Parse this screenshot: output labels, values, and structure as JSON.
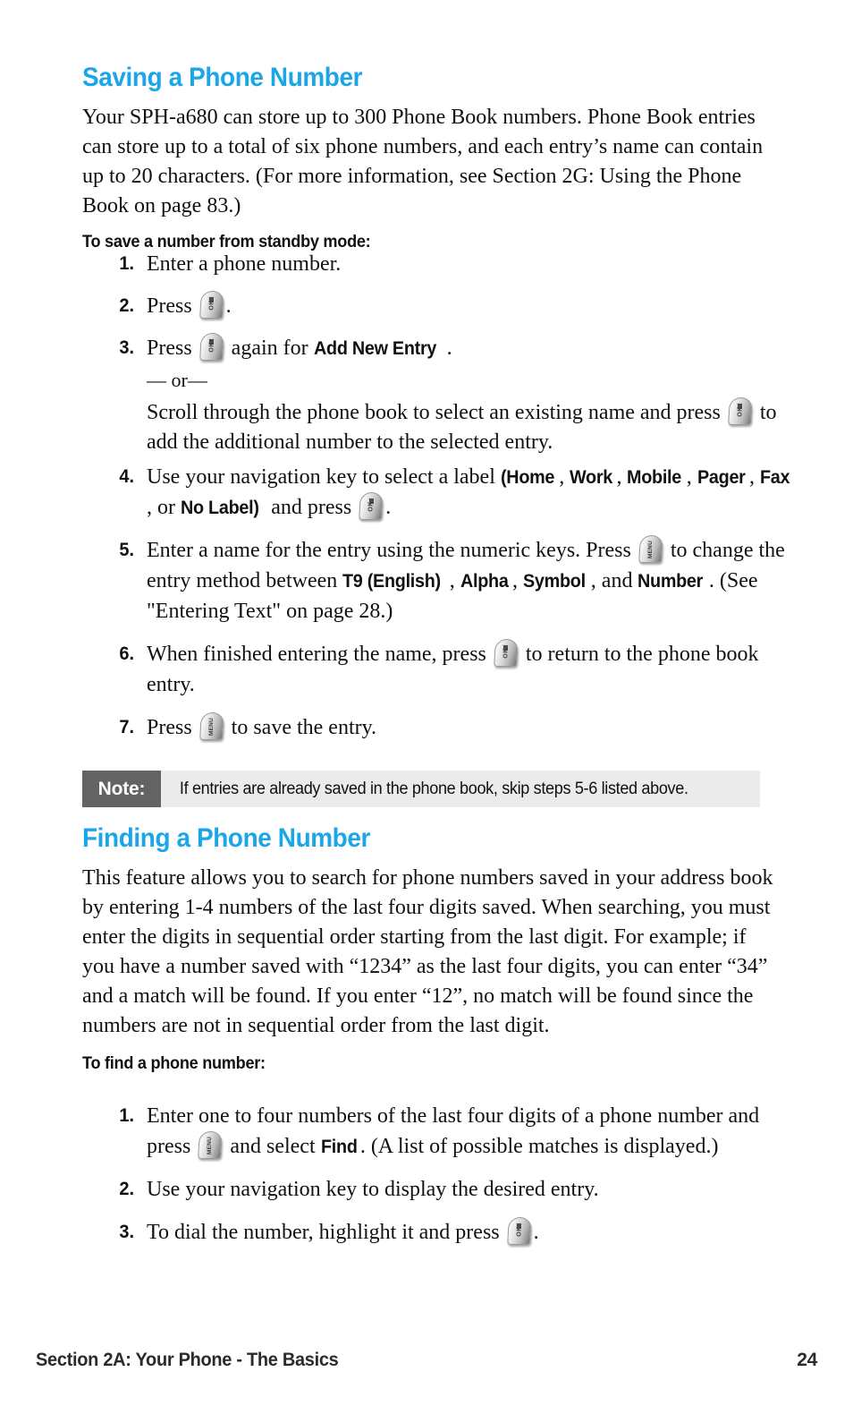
{
  "document": {
    "page_number": "24",
    "footer_left": "Section 2A: Your Phone - The Basics",
    "accent_color": "#1BA6E8",
    "note_label_bg": "#636363",
    "note_body_bg": "#ebebeb"
  },
  "sections": [
    {
      "heading": "Saving a Phone Number",
      "intro": "Your SPH-a680 can store up to 300 Phone Book numbers. Phone Book entries can store up to a total of six phone numbers, and each entry’s name can contain up to 20 characters. (For more information, see Section 2G: Using the Phone Book on page 83.)",
      "subheading": "To save a number from standby mode:",
      "steps": [
        {
          "num": "1.",
          "text": "Enter a phone number."
        },
        {
          "num": "2.",
          "text_before": "Press ",
          "icon": "ok-key-icon",
          "text_after": "."
        },
        {
          "num": "3.",
          "text_before": "Press ",
          "icon": "ok-key-icon",
          "text_mid": " again for ",
          "bold1": "Add New Entry",
          "text_after": "."
        },
        {
          "num": "4.",
          "text_before": "Use your navigation key to select a label ",
          "bold_open": "(Home",
          "b_sep1": ", ",
          "bold2": "Work",
          "b_sep2": ", ",
          "bold3": "Mobile",
          "b_sep3": ", ",
          "bold4": "Pager",
          "b_sep4": ", ",
          "bold5": "Fax",
          "b_sep5": ", or ",
          "bold6": "No Label)",
          "text_mid": " and press ",
          "icon": "ok-key-icon",
          "text_after": "."
        },
        {
          "num": "5.",
          "text_before": "Enter a name for the entry using the numeric keys. Press ",
          "icon": "menu-key-icon",
          "text_mid": " to change the entry method between ",
          "bold1": "T9 (English)",
          "b_sep1": ", ",
          "bold2": "Alpha",
          "b_sep2": ", ",
          "bold3": "Symbol",
          "b_sep3": ", and ",
          "bold4": "Number",
          "text_after": ". (See \"Entering Text\" on page 28.)"
        },
        {
          "num": "6.",
          "text_before": "When finished entering the name, press ",
          "icon": "ok-key-icon",
          "text_after": " to return to the phone book entry."
        },
        {
          "num": "7.",
          "text_before": "Press ",
          "icon": "menu-key-icon",
          "text_after": " to save the entry."
        }
      ],
      "or_divider": "— or—",
      "or_body_before": "Scroll through the phone book to select an existing name and press ",
      "or_body_after": " to add the additional number to the selected entry."
    },
    {
      "heading": "Finding a Phone Number",
      "intro": "This feature allows you to search for phone numbers saved in your address book by entering 1-4 numbers of the last four digits saved. When searching, you must enter the digits in sequential order starting from the last digit. For example; if you have a number saved with “1234” as the last four digits, you can enter “34” and a match will be found. If you enter “12”, no match will be found since the numbers are not in sequential order from the last digit.",
      "subheading": "To find a phone number:",
      "steps": [
        {
          "num": "1.",
          "text_before": "Enter one to four numbers of the last four digits of a phone number and press ",
          "icon": "menu-key-icon",
          "text_mid": " and select ",
          "bold1": "Find",
          "text_after": ". (A list of possible matches is displayed.)"
        },
        {
          "num": "2.",
          "text": "Use your navigation key to display the desired entry."
        },
        {
          "num": "3.",
          "text_before": "To dial the number, highlight it and press ",
          "icon": "ok-key-icon",
          "text_after": "."
        }
      ]
    }
  ],
  "note": {
    "label": "Note:",
    "text": "If entries are already saved in the phone book, skip steps 5-6 listed above."
  },
  "icons": {
    "ok_key_glyph": "OK",
    "menu_key_glyph": "MENU"
  }
}
